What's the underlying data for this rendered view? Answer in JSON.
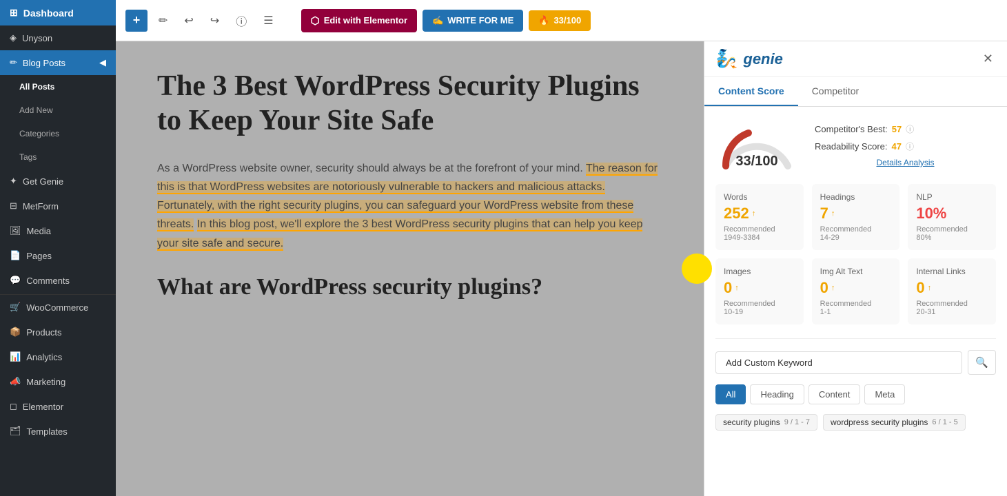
{
  "sidebar": {
    "header": {
      "label": "Dashboard"
    },
    "items": [
      {
        "id": "dashboard",
        "label": "Dashboard",
        "icon": "⊞"
      },
      {
        "id": "unyson",
        "label": "Unyson",
        "icon": "◈"
      },
      {
        "id": "blog-posts",
        "label": "Blog Posts",
        "icon": "✏",
        "active": true
      },
      {
        "id": "all-posts",
        "label": "All Posts",
        "sub": true,
        "active_sub": true
      },
      {
        "id": "add-new",
        "label": "Add New",
        "sub": true
      },
      {
        "id": "categories",
        "label": "Categories",
        "sub": true
      },
      {
        "id": "tags",
        "label": "Tags",
        "sub": true
      },
      {
        "id": "get-genie",
        "label": "Get Genie",
        "icon": "✦"
      },
      {
        "id": "metform",
        "label": "MetForm",
        "icon": "⊟"
      },
      {
        "id": "media",
        "label": "Media",
        "icon": "🖼"
      },
      {
        "id": "pages",
        "label": "Pages",
        "icon": "📄"
      },
      {
        "id": "comments",
        "label": "Comments",
        "icon": "💬"
      },
      {
        "id": "woocommerce",
        "label": "WooCommerce",
        "icon": "🛒"
      },
      {
        "id": "products",
        "label": "Products",
        "icon": "📦"
      },
      {
        "id": "analytics",
        "label": "Analytics",
        "icon": "📊"
      },
      {
        "id": "marketing",
        "label": "Marketing",
        "icon": "📣"
      },
      {
        "id": "elementor",
        "label": "Elementor",
        "icon": "◻"
      },
      {
        "id": "templates",
        "label": "Templates",
        "icon": "🗂"
      }
    ]
  },
  "toolbar": {
    "add_label": "+",
    "edit_icon": "✏",
    "undo_icon": "↩",
    "redo_icon": "↪",
    "info_icon": "ⓘ",
    "menu_icon": "☰",
    "edit_elementor_label": "Edit with Elementor",
    "write_for_me_label": "WRITE FOR ME",
    "score_badge_label": "33/100"
  },
  "editor": {
    "post_title": "The 3 Best WordPress Security Plugins to Keep Your Site Safe",
    "post_body_1": "As a WordPress website owner, security should always be at the forefront of your mind.",
    "post_body_2": "The reason for this is that WordPress websites are notoriously vulnerable to hackers and malicious attacks. Fortunately, with the right security plugins, you can safeguard your WordPress website from these threats.",
    "post_body_3": "In this blog post, we'll explore the 3 best WordPress security plugins that can help you keep your site safe and secure.",
    "section_title": "What are WordPress security plugins?"
  },
  "panel": {
    "logo_text": "genie",
    "tabs": [
      {
        "id": "content-score",
        "label": "Content Score",
        "active": true
      },
      {
        "id": "competitor",
        "label": "Competitor",
        "active": false
      }
    ],
    "score": {
      "value": "33",
      "max": "100",
      "display": "33/100"
    },
    "competitor_best_label": "Competitor's Best:",
    "competitor_best_value": "57",
    "readability_score_label": "Readability Score:",
    "readability_score_value": "47",
    "details_link": "Details Analysis",
    "metrics": [
      {
        "id": "words",
        "label": "Words",
        "value": "252",
        "arrow": "↑",
        "recommended_label": "Recommended",
        "recommended_value": "1949-3384"
      },
      {
        "id": "headings",
        "label": "Headings",
        "value": "7",
        "arrow": "↑",
        "recommended_label": "Recommended",
        "recommended_value": "14-29"
      },
      {
        "id": "nlp",
        "label": "NLP",
        "value": "10%",
        "arrow": "",
        "recommended_label": "Recommended",
        "recommended_value": "80%",
        "color": "red"
      },
      {
        "id": "images",
        "label": "Images",
        "value": "0",
        "arrow": "↑",
        "recommended_label": "Recommended",
        "recommended_value": "10-19"
      },
      {
        "id": "img-alt-text",
        "label": "Img Alt Text",
        "value": "0",
        "arrow": "↑",
        "recommended_label": "Recommended",
        "recommended_value": "1-1"
      },
      {
        "id": "internal-links",
        "label": "Internal Links",
        "value": "0",
        "arrow": "↑",
        "recommended_label": "Recommended",
        "recommended_value": "20-31"
      }
    ],
    "add_keyword_label": "Add Custom Keyword",
    "search_icon": "🔍",
    "filter_tabs": [
      {
        "id": "all",
        "label": "All",
        "active": true
      },
      {
        "id": "heading",
        "label": "Heading",
        "active": false
      },
      {
        "id": "content",
        "label": "Content",
        "active": false
      },
      {
        "id": "meta",
        "label": "Meta",
        "active": false
      }
    ],
    "keyword_tags": [
      {
        "text": "security plugins",
        "count": "9 / 1 - 7"
      },
      {
        "text": "wordpress security plugins",
        "count": "6 / 1 - 5"
      }
    ]
  }
}
